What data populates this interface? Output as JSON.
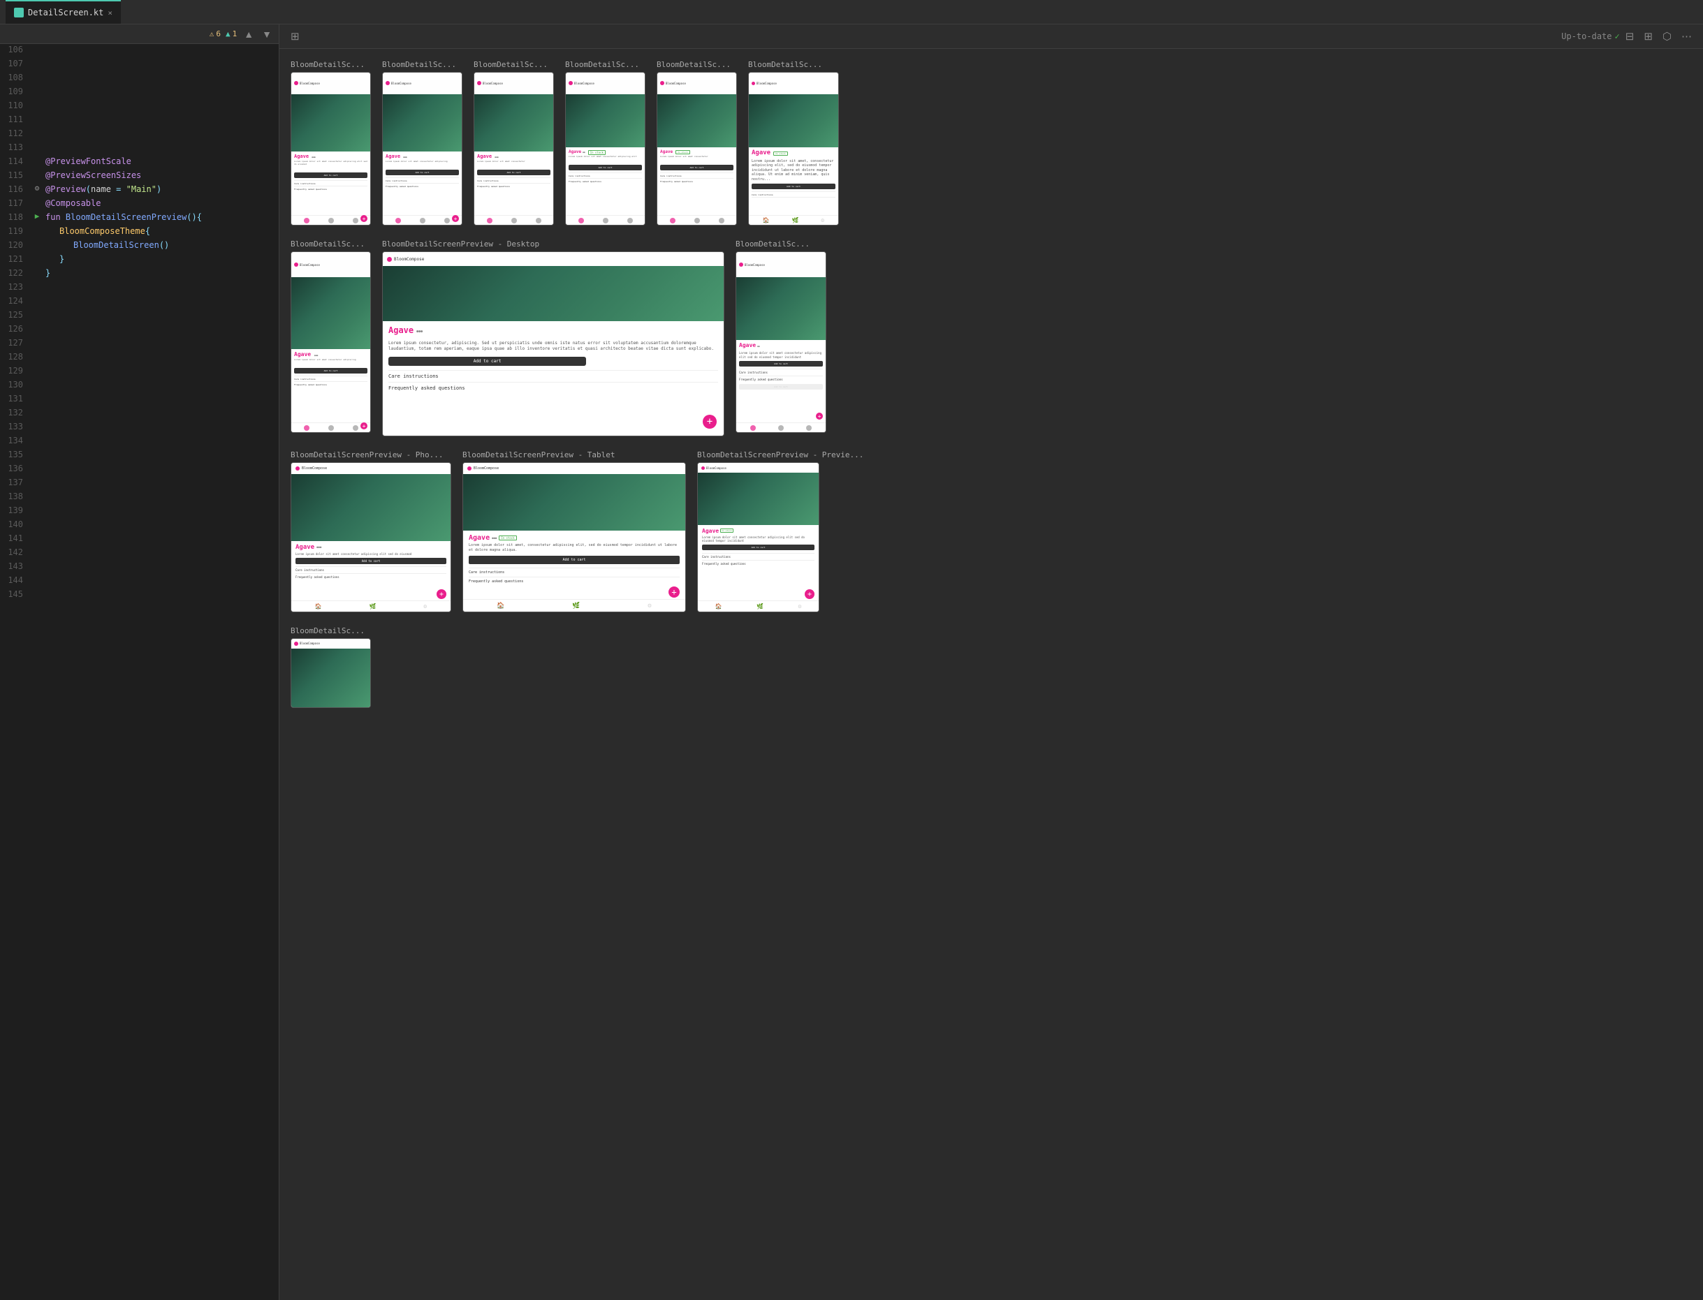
{
  "tab": {
    "icon": "kt",
    "filename": "DetailScreen.kt",
    "close_label": "×"
  },
  "code_toolbar": {
    "warning_count": "6",
    "info_count": "1",
    "up_icon": "▲",
    "down_icon": "▼"
  },
  "preview_toolbar": {
    "grid_icon": "⊞",
    "status": "Up-to-date",
    "status_icon": "✓",
    "layout_icon": "⊟",
    "gallery_icon": "⊞",
    "share_icon": "⬡",
    "more_icon": "⋯"
  },
  "code_lines": [
    {
      "num": "106",
      "content": ""
    },
    {
      "num": "107",
      "content": ""
    },
    {
      "num": "108",
      "content": ""
    },
    {
      "num": "109",
      "content": ""
    },
    {
      "num": "110",
      "content": ""
    },
    {
      "num": "111",
      "content": ""
    },
    {
      "num": "112",
      "content": ""
    },
    {
      "num": "113",
      "content": ""
    },
    {
      "num": "114",
      "content": "@PreviewFontScale",
      "type": "annotation"
    },
    {
      "num": "115",
      "content": "@PreviewScreenSizes",
      "type": "annotation"
    },
    {
      "num": "116",
      "content": "@Preview(name = \"Main\")",
      "type": "annotation",
      "has_gear": true
    },
    {
      "num": "117",
      "content": "@Composable",
      "type": "annotation"
    },
    {
      "num": "118",
      "content": "fun BloomDetailScreenPreview(){",
      "type": "function",
      "has_run": true
    },
    {
      "num": "119",
      "content": "    BloomComposeTheme{",
      "type": "class"
    },
    {
      "num": "120",
      "content": "        BloomDetailScreen()",
      "type": "call"
    },
    {
      "num": "121",
      "content": "    }",
      "type": "punc"
    },
    {
      "num": "122",
      "content": "}",
      "type": "punc"
    },
    {
      "num": "123",
      "content": ""
    },
    {
      "num": "124",
      "content": ""
    },
    {
      "num": "125",
      "content": ""
    },
    {
      "num": "126",
      "content": ""
    },
    {
      "num": "127",
      "content": ""
    },
    {
      "num": "128",
      "content": ""
    },
    {
      "num": "129",
      "content": ""
    },
    {
      "num": "130",
      "content": ""
    },
    {
      "num": "131",
      "content": ""
    },
    {
      "num": "132",
      "content": ""
    },
    {
      "num": "133",
      "content": ""
    },
    {
      "num": "134",
      "content": ""
    },
    {
      "num": "135",
      "content": ""
    },
    {
      "num": "136",
      "content": ""
    },
    {
      "num": "137",
      "content": ""
    },
    {
      "num": "138",
      "content": ""
    },
    {
      "num": "139",
      "content": ""
    },
    {
      "num": "140",
      "content": ""
    },
    {
      "num": "141",
      "content": ""
    },
    {
      "num": "142",
      "content": ""
    },
    {
      "num": "143",
      "content": ""
    },
    {
      "num": "144",
      "content": ""
    },
    {
      "num": "145",
      "content": ""
    }
  ],
  "previews_row1": [
    {
      "label": "BloomDetailSc...",
      "type": "phone"
    },
    {
      "label": "BloomDetailSc...",
      "type": "phone"
    },
    {
      "label": "BloomDetailSc...",
      "type": "phone"
    },
    {
      "label": "BloomDetailSc...",
      "type": "phone"
    },
    {
      "label": "BloomDetailSc...",
      "type": "phone"
    },
    {
      "label": "BloomDetailSc...",
      "type": "phone_large"
    }
  ],
  "previews_row2": [
    {
      "label": "BloomDetailSc...",
      "type": "phone"
    },
    {
      "label": "BloomDetailScreenPreview - Desktop",
      "type": "desktop"
    },
    {
      "label": "BloomDetailSc...",
      "type": "phone_large_2"
    }
  ],
  "previews_row3": [
    {
      "label": "BloomDetailScreenPreview - Pho...",
      "type": "phone_wide"
    },
    {
      "label": "BloomDetailScreenPreview - Tablet",
      "type": "tablet"
    },
    {
      "label": "BloomDetailScreenPreview - Previe...",
      "type": "tablet_2"
    }
  ],
  "previews_row4": [
    {
      "label": "BloomDetailSc...",
      "type": "phone"
    }
  ],
  "plant": {
    "name": "Agave",
    "in_stock": "In stock",
    "care_instructions": "Care instructions",
    "faq": "Frequently asked questions",
    "add_to_cart": "Add to cart",
    "lorem": "Lorem ipsum dolor sit amet, consectetur adipiscing elit, sed do eiusmod tempor incididunt ut labore et dolore magna aliqua."
  },
  "nav_tabs": {
    "home": "Home",
    "my_plants": "MyPlants",
    "settings": "Settings"
  }
}
